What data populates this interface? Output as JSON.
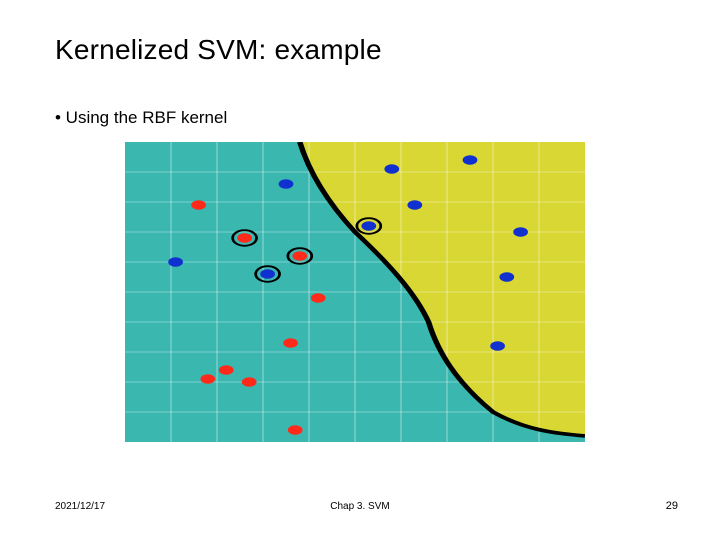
{
  "slide": {
    "title": "Kernelized SVM: example",
    "bullet": "• Using the RBF kernel",
    "footer": {
      "date": "2021/12/17",
      "chapter": "Chap 3. SVM",
      "page": "29"
    }
  },
  "chart_data": {
    "type": "scatter",
    "title": "",
    "xlabel": "",
    "ylabel": "",
    "xlim": [
      0,
      100
    ],
    "ylim": [
      0,
      100
    ],
    "decision_boundary": [
      {
        "x": 38,
        "y": 100
      },
      {
        "x": 40,
        "y": 90
      },
      {
        "x": 44,
        "y": 80
      },
      {
        "x": 50,
        "y": 70
      },
      {
        "x": 57,
        "y": 60
      },
      {
        "x": 63,
        "y": 50
      },
      {
        "x": 66,
        "y": 40
      },
      {
        "x": 68,
        "y": 30
      },
      {
        "x": 72,
        "y": 20
      },
      {
        "x": 80,
        "y": 10
      },
      {
        "x": 93,
        "y": 3
      },
      {
        "x": 100,
        "y": 2
      }
    ],
    "regions": [
      {
        "name": "left",
        "color": "#3ab8b0"
      },
      {
        "name": "right",
        "color": "#d9d733"
      }
    ],
    "series": [
      {
        "name": "class-red",
        "color": "#ff2a1a",
        "points": [
          {
            "x": 16,
            "y": 79
          },
          {
            "x": 18,
            "y": 21
          },
          {
            "x": 22,
            "y": 24
          },
          {
            "x": 27,
            "y": 20
          },
          {
            "x": 37,
            "y": 4
          },
          {
            "x": 36,
            "y": 33
          },
          {
            "x": 42,
            "y": 48
          }
        ]
      },
      {
        "name": "class-red-sv",
        "color": "#ff2a1a",
        "ring": true,
        "points": [
          {
            "x": 26,
            "y": 68
          },
          {
            "x": 38,
            "y": 62
          }
        ]
      },
      {
        "name": "class-blue",
        "color": "#1030d0",
        "points": [
          {
            "x": 11,
            "y": 60
          },
          {
            "x": 35,
            "y": 86
          },
          {
            "x": 58,
            "y": 91
          },
          {
            "x": 63,
            "y": 79
          },
          {
            "x": 75,
            "y": 94
          },
          {
            "x": 86,
            "y": 70
          },
          {
            "x": 83,
            "y": 55
          },
          {
            "x": 81,
            "y": 32
          }
        ]
      },
      {
        "name": "class-blue-sv",
        "color": "#1030d0",
        "ring": true,
        "points": [
          {
            "x": 31,
            "y": 56
          },
          {
            "x": 53,
            "y": 72
          }
        ]
      }
    ]
  }
}
